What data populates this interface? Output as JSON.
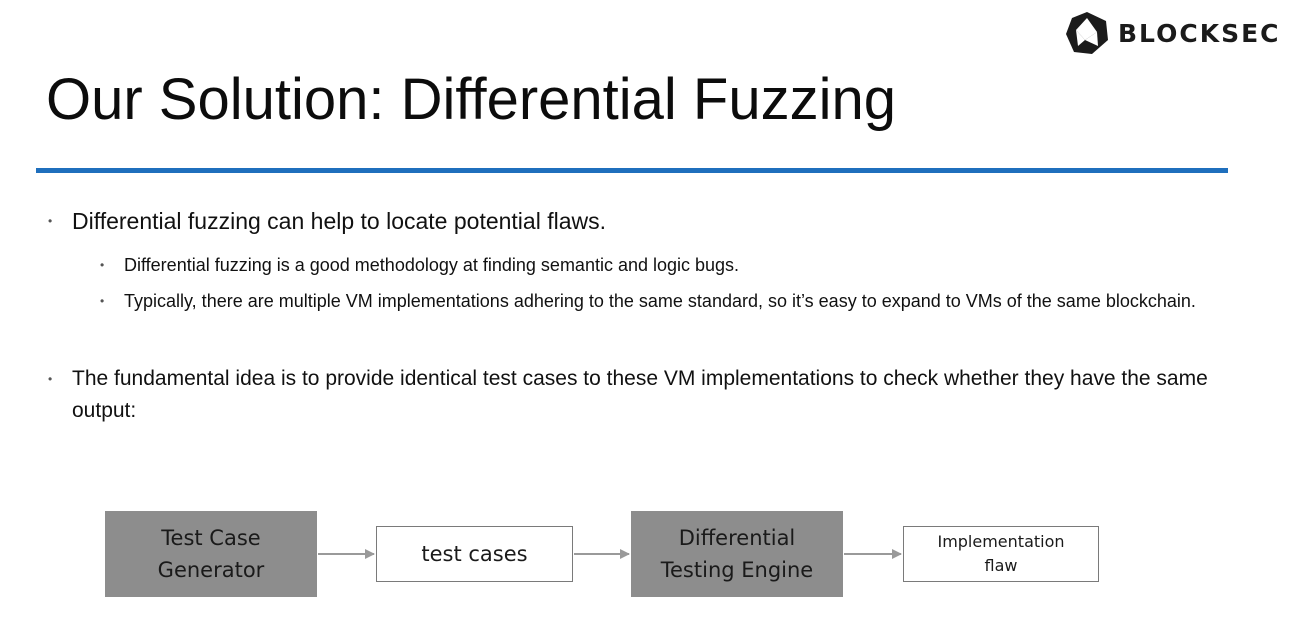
{
  "logo": {
    "text": "BLOCKSEC"
  },
  "slide": {
    "title": "Our Solution: Differential Fuzzing",
    "bullets": [
      {
        "text": "Differential fuzzing can help to locate potential flaws."
      },
      {
        "text": "Differential fuzzing is a good methodology at finding semantic and logic bugs."
      },
      {
        "text": "Typically, there are multiple VM implementations adhering to the same standard, so it’s easy to expand to VMs of the same blockchain."
      },
      {
        "text": "The fundamental idea is to provide identical test cases to these VM implementations to check whether they have the same output:"
      }
    ]
  },
  "diagram": {
    "nodes": [
      {
        "label": "Test Case Generator"
      },
      {
        "label": "test cases"
      },
      {
        "label": "Differential Testing Engine"
      },
      {
        "label": "Implementation flaw"
      }
    ]
  },
  "colors": {
    "accent": "#1f6fbd",
    "box_fill": "#8d8d8d",
    "arrow": "#9a9a9a"
  }
}
